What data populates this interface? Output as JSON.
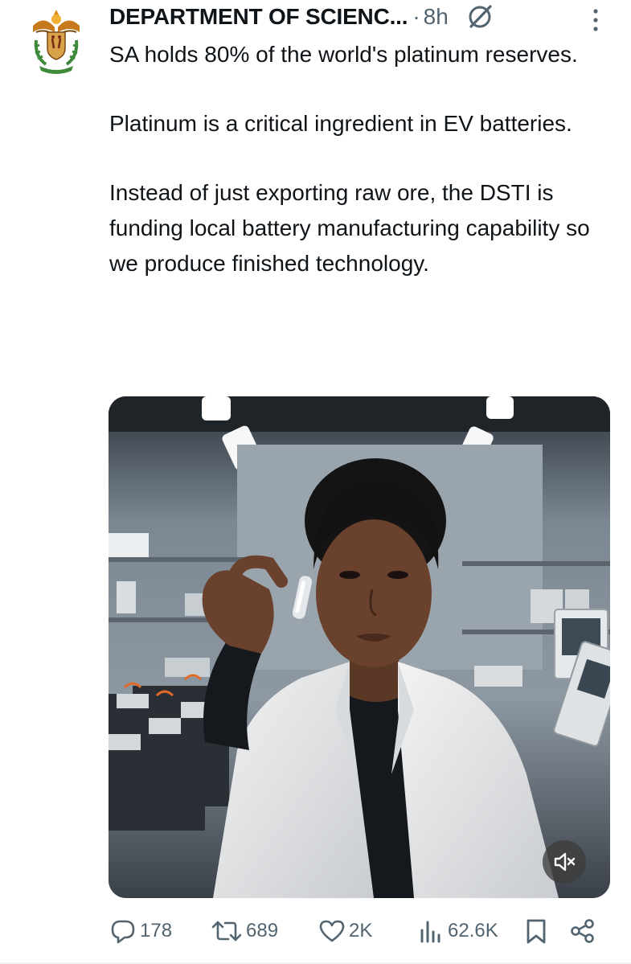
{
  "post": {
    "author_name": "DEPARTMENT OF SCIENC...",
    "separator": "·",
    "time_ago": "8h",
    "paragraphs": [
      "SA holds 80% of the world's platinum reserves.",
      "Platinum is a critical ingredient in EV batteries.",
      "Instead of just exporting raw ore, the DSTI is funding local battery manufacturing capability so we produce finished technology."
    ]
  },
  "media": {
    "type": "video",
    "muted": true
  },
  "actions": {
    "replies": "178",
    "reposts": "689",
    "likes": "2K",
    "views": "62.6K"
  },
  "colors": {
    "text": "#0f1419",
    "secondary": "#536471"
  },
  "icons": [
    "coat-of-arms-avatar",
    "grok-icon",
    "more-options-icon",
    "mute-icon",
    "reply-icon",
    "repost-icon",
    "like-icon",
    "views-icon",
    "bookmark-icon",
    "share-icon"
  ]
}
